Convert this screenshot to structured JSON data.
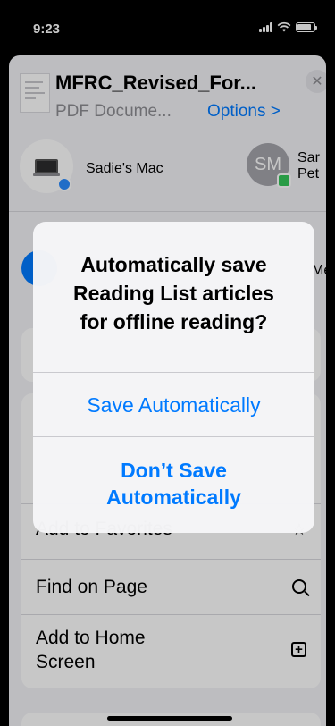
{
  "status_bar": {
    "time": "9:23"
  },
  "share_sheet": {
    "document_title": "MFRC_Revised_For...",
    "document_subtitle": "PDF Docume...",
    "options_label": "Options >",
    "close_icon": "close-icon",
    "airdrop": [
      {
        "name": "Sadie's Mac",
        "icon": "laptop-icon"
      },
      {
        "initials": "SM",
        "name_fragment_1": "Sar",
        "name_fragment_2": "Pet"
      }
    ],
    "app_label_fragment": "Me",
    "actions": {
      "add_to_favorites": "Add to Favorites",
      "find_on_page": "Find on Page",
      "add_to_home_screen_line1": "Add to Home",
      "add_to_home_screen_line2": "Screen"
    }
  },
  "alert": {
    "title_line1": "Automatically save",
    "title_line2": "Reading List articles",
    "title_line3": "for offline reading?",
    "save_button": "Save Automatically",
    "dont_save_line1": "Don’t Save",
    "dont_save_line2": "Automatically"
  }
}
